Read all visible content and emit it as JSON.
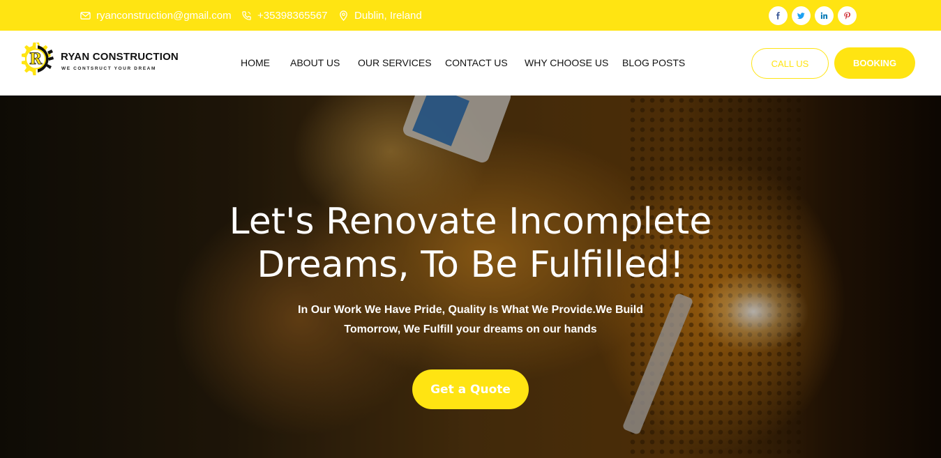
{
  "topbar": {
    "email": "ryanconstruction@gmail.com",
    "phone": "+35398365567",
    "location": "Dublin, Ireland",
    "socials": [
      {
        "icon": "facebook-icon",
        "label": "f",
        "color": "#3b5998"
      },
      {
        "icon": "twitter-icon",
        "label": "t",
        "color": "#1da1f2"
      },
      {
        "icon": "linkedin-icon",
        "label": "in",
        "color": "#0077b5"
      },
      {
        "icon": "pinterest-icon",
        "label": "p",
        "color": "#cb2027"
      }
    ]
  },
  "header": {
    "brand": "RYAN CONSTRUCTION",
    "tagline": "WE CONTSRUCT YOUR DREAM",
    "logo_letter": "R",
    "nav": [
      "HOME",
      "ABOUT US",
      "OUR SERVICES",
      "CONTACT US",
      "WHY CHOOSE US",
      "BLOG POSTS"
    ],
    "call_button": "CALL US",
    "booking_button": "BOOKING"
  },
  "hero": {
    "title_line1": "Let's Renovate Incomplete",
    "title_line2": "Dreams, To Be Fulfilled!",
    "subtitle_line1": "In Our Work We Have Pride, Quality Is What We Provide.We Build",
    "subtitle_line2": "Tomorrow, We Fulfill your dreams on our hands",
    "cta": "Get a Quote"
  },
  "colors": {
    "accent": "#FFE412",
    "text_dark": "#111111",
    "white": "#ffffff"
  }
}
